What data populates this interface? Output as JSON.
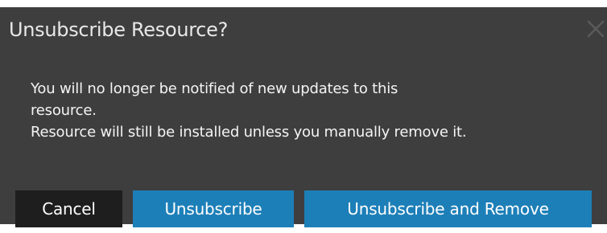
{
  "dialog": {
    "title": "Unsubscribe Resource?",
    "close_icon": "close-icon",
    "message_line1": "You will no longer be notified of new updates to this",
    "message_line2": "resource.",
    "message_line3": "Resource will still be installed unless you manually remove it."
  },
  "buttons": {
    "cancel_label": "Cancel",
    "unsubscribe_label": "Unsubscribe",
    "unsubscribe_remove_label": "Unsubscribe and Remove"
  },
  "colors": {
    "dialog_background": "#3e3e3e",
    "primary_button": "#1d7fb8",
    "cancel_button": "#1e1e1e",
    "close_icon": "#5a5a5a"
  }
}
